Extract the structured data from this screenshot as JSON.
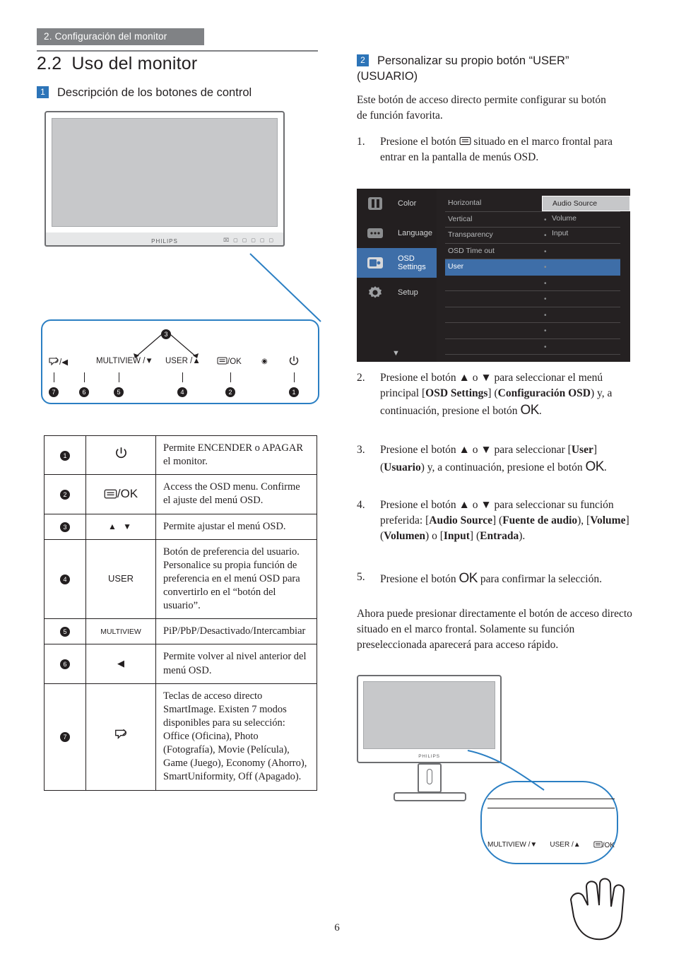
{
  "header": {
    "tab": "2. Configuración del monitor"
  },
  "section": {
    "number": "2.2",
    "title": "Uso del monitor",
    "sub1_num": "1",
    "sub1_title": "Descripción de los botones de control"
  },
  "monitor_illustration": {
    "brand": "PHILIPS",
    "button_strip": "⌧ ▢ ▢ ▢ ▢ ▢"
  },
  "button_row": {
    "items": [
      {
        "label": "/◀",
        "icon": "smartimage-icon",
        "num": "7"
      },
      {
        "label": "",
        "icon": "",
        "num": "6"
      },
      {
        "label": "MULTIVIEW /▼",
        "icon": "multiview",
        "num": "5"
      },
      {
        "label": "USER /▲",
        "icon": "user",
        "num": "4"
      },
      {
        "label": "/OK",
        "icon": "menu-ok",
        "num": "2"
      },
      {
        "label": "",
        "icon": "led",
        "num": ""
      },
      {
        "label": "",
        "icon": "power",
        "num": "1"
      }
    ],
    "top_marker": "3"
  },
  "control_table": {
    "rows": [
      {
        "num": "1",
        "icon": "power-icon",
        "icon_text": "",
        "desc": "Permite ENCENDER o APAGAR el monitor."
      },
      {
        "num": "2",
        "icon": "menu-ok-icon",
        "icon_text": "/OK",
        "desc": "Access the OSD menu. Confirme el ajuste del menú OSD."
      },
      {
        "num": "3",
        "icon": "up-down-arrows-icon",
        "icon_text": "▲ ▼",
        "desc": "Permite ajustar el menú OSD."
      },
      {
        "num": "4",
        "icon": "user-icon",
        "icon_text": "USER",
        "desc": "Botón de preferencia del usuario. Personalice su propia función de preferencia en el menú OSD para convertirlo en el “botón del usuario”."
      },
      {
        "num": "5",
        "icon": "multiview-icon",
        "icon_text": "MULTIVIEW",
        "desc": "PiP/PbP/Desactivado/Intercambiar"
      },
      {
        "num": "6",
        "icon": "back-arrow-icon",
        "icon_text": "◀",
        "desc": "Permite volver al nivel anterior del menú OSD."
      },
      {
        "num": "7",
        "icon": "smartimage-icon",
        "icon_text": "",
        "desc": "Teclas de acceso directo SmartImage. Existen 7 modos disponibles para su selección: Office (Oficina), Photo (Fotografía), Movie (Película), Game (Juego), Economy (Ahorro), SmartUniformity, Off (Apagado)."
      }
    ]
  },
  "right": {
    "sub2_num": "2",
    "sub2_title_line1": "Personalizar su propio botón “USER”",
    "sub2_title_line2": "(USUARIO)",
    "intro": "Este botón de acceso directo permite configurar su botón de función favorita.",
    "steps": [
      {
        "n": "1.",
        "html": "Presione el botón <span class='ic' data-name='menu-icon'>▤</span> situado en el marco frontal para entrar en la pantalla de menús OSD."
      },
      {
        "n": "2.",
        "html": "Presione el botón ▲ o ▼ para seleccionar el menú principal [<b>OSD Settings</b>] (<b>Configuración OSD</b>) y, a continuación, presione el botón <span class='ok'>OK</span>."
      },
      {
        "n": "3.",
        "html": "Presione el botón ▲ o ▼ para seleccionar [<b>User</b>] (<b>Usuario</b>) y, a continuación, presione el botón <span class='ok'>OK</span>."
      },
      {
        "n": "4.",
        "html": "Presione el botón ▲ o ▼ para seleccionar su función preferida: [<b>Audio Source</b>] (<b>Fuente de audio</b>), [<b>Volume</b>] (<b>Volumen</b>) o [<b>Input</b>] (<b>Entrada</b>)."
      },
      {
        "n": "5.",
        "html": "Presione el botón <span class='ok'>OK</span> para confirmar la selección."
      }
    ],
    "closing": "Ahora puede presionar directamente el botón de acceso directo situado en el marco frontal. Solamente su función preseleccionada aparecerá para acceso rápido."
  },
  "osd": {
    "menu_items": [
      {
        "label": "Color",
        "icon": "color-icon",
        "selected": false
      },
      {
        "label": "Language",
        "icon": "language-icon",
        "selected": false
      },
      {
        "label": "OSD Settings",
        "icon": "osd-settings-icon",
        "selected": true
      },
      {
        "label": "Setup",
        "icon": "setup-icon",
        "selected": false
      }
    ],
    "scroll_down": "▼",
    "sub_items": [
      {
        "label": "Horizontal",
        "dot": "•",
        "selected": false
      },
      {
        "label": "Vertical",
        "dot": "•",
        "selected": false
      },
      {
        "label": "Transparency",
        "dot": "•",
        "selected": false
      },
      {
        "label": "OSD Time out",
        "dot": "•",
        "selected": false
      },
      {
        "label": "User",
        "dot": "•",
        "selected": true
      },
      {
        "label": "",
        "dot": "•",
        "selected": false
      },
      {
        "label": "",
        "dot": "•",
        "selected": false
      },
      {
        "label": "",
        "dot": "•",
        "selected": false
      },
      {
        "label": "",
        "dot": "•",
        "selected": false
      },
      {
        "label": "",
        "dot": "•",
        "selected": false
      }
    ],
    "values": [
      {
        "label": "Audio Source",
        "selected": true
      },
      {
        "label": "Volume",
        "selected": false
      },
      {
        "label": "Input",
        "selected": false
      }
    ]
  },
  "bottom_illustration": {
    "brand": "PHILIPS",
    "labels": [
      "MULTIVIEW /▼",
      "USER /▲",
      "/OK"
    ]
  },
  "page_number": "6",
  "colors": {
    "accent_blue": "#2c74b8",
    "callout_blue": "#2b7fc3",
    "header_gray": "#808285",
    "osd_bg": "#231f20",
    "osd_select": "#3e6ea8"
  }
}
